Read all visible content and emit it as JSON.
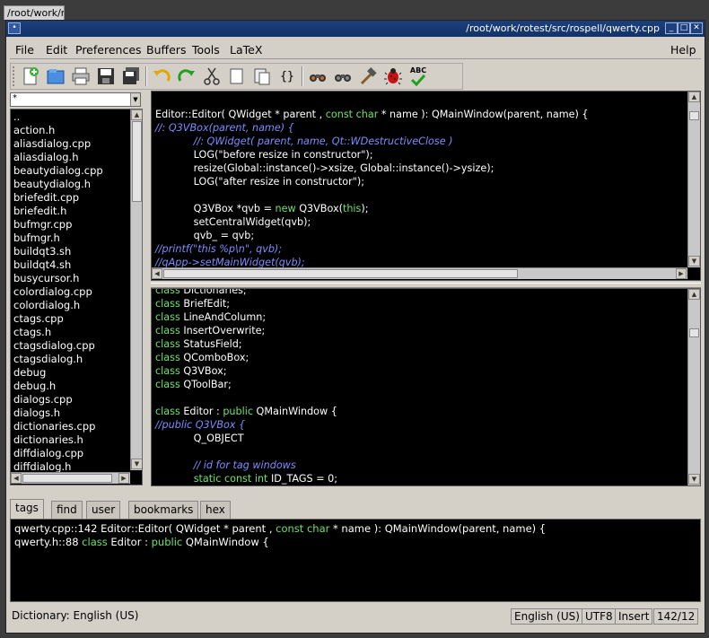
{
  "taskbar_tab": "/root/work/ro",
  "window": {
    "title": "/root/work/rotest/src/rospell/qwerty.cpp",
    "controls": {
      "minimize": "_",
      "maximize": "□",
      "close": "✕"
    }
  },
  "menubar": {
    "items": [
      "File",
      "Edit",
      "Preferences",
      "Buffers",
      "Tools",
      "LaTeX"
    ],
    "help": "Help"
  },
  "toolbar": {
    "buttons": [
      "new-file-icon",
      "open-file-icon",
      "print-icon",
      "save-icon",
      "save-all-icon",
      "undo-icon",
      "redo-icon",
      "cut-icon",
      "copy-icon",
      "paste-icon",
      "braces-icon",
      "find-icon",
      "find-next-icon",
      "build-icon",
      "debug-icon",
      "spellcheck-icon"
    ],
    "braces_label": "{}",
    "spell_label": "ABC"
  },
  "file_panel": {
    "filter_value": "*",
    "files": [
      "..",
      "action.h",
      "aliasdialog.cpp",
      "aliasdialog.h",
      "beautydialog.cpp",
      "beautydialog.h",
      "briefedit.cpp",
      "briefedit.h",
      "bufmgr.cpp",
      "bufmgr.h",
      "buildqt3.sh",
      "buildqt4.sh",
      "busycursor.h",
      "colordialog.cpp",
      "colordialog.h",
      "ctags.cpp",
      "ctags.h",
      "ctagsdialog.cpp",
      "ctagsdialog.h",
      "debug",
      "debug.h",
      "dialogs.cpp",
      "dialogs.h",
      "dictionaries.cpp",
      "dictionaries.h",
      "diffdialog.cpp",
      "diffdialog.h"
    ]
  },
  "editor_top": {
    "lines": [
      [
        {
          "t": ""
        }
      ],
      [
        {
          "t": "Editor::Editor( QWidget * parent , "
        },
        {
          "t": "const char",
          "c": "kw"
        },
        {
          "t": " * name ): QMainWindow(parent, name) {"
        }
      ],
      [
        {
          "t": "//: Q3VBox(parent, name) {",
          "c": "cm"
        }
      ],
      [
        {
          "t": "            "
        },
        {
          "t": "//: QWidget( parent, name, Qt::WDestructiveClose )",
          "c": "cm"
        }
      ],
      [
        {
          "t": "            LOG(\"before resize in constructor\");"
        }
      ],
      [
        {
          "t": "            resize(Global::instance()->xsize, Global::instance()->ysize);"
        }
      ],
      [
        {
          "t": "            LOG(\"after resize in constructor\");"
        }
      ],
      [
        {
          "t": ""
        }
      ],
      [
        {
          "t": "            Q3VBox *qvb = "
        },
        {
          "t": "new",
          "c": "kw"
        },
        {
          "t": " Q3VBox("
        },
        {
          "t": "this",
          "c": "kw"
        },
        {
          "t": ");"
        }
      ],
      [
        {
          "t": "            setCentralWidget(qvb);"
        }
      ],
      [
        {
          "t": "            qvb_ = qvb;"
        }
      ],
      [
        {
          "t": "//printf(\"this %p\\n\", qvb);",
          "c": "cm"
        }
      ],
      [
        {
          "t": "//qApp->setMainWidget(qvb);",
          "c": "cm"
        }
      ]
    ]
  },
  "editor_bottom": {
    "lines": [
      [
        {
          "t": "class",
          "c": "kw"
        },
        {
          "t": " Dictionaries;"
        }
      ],
      [
        {
          "t": "class",
          "c": "kw"
        },
        {
          "t": " BriefEdit;"
        }
      ],
      [
        {
          "t": "class",
          "c": "kw"
        },
        {
          "t": " LineAndColumn;"
        }
      ],
      [
        {
          "t": "class",
          "c": "kw"
        },
        {
          "t": " InsertOverwrite;"
        }
      ],
      [
        {
          "t": "class",
          "c": "kw"
        },
        {
          "t": " StatusField;"
        }
      ],
      [
        {
          "t": "class",
          "c": "kw"
        },
        {
          "t": " QComboBox;"
        }
      ],
      [
        {
          "t": "class",
          "c": "kw"
        },
        {
          "t": " Q3VBox;"
        }
      ],
      [
        {
          "t": "class",
          "c": "kw"
        },
        {
          "t": " QToolBar;"
        }
      ],
      [
        {
          "t": ""
        }
      ],
      [
        {
          "t": "class",
          "c": "kw"
        },
        {
          "t": " Editor : "
        },
        {
          "t": "public",
          "c": "kw"
        },
        {
          "t": " QMainWindow {"
        }
      ],
      [
        {
          "t": "//public Q3VBox {",
          "c": "cm"
        }
      ],
      [
        {
          "t": "            Q_OBJECT"
        }
      ],
      [
        {
          "t": ""
        }
      ],
      [
        {
          "t": "            "
        },
        {
          "t": "// id for tag windows",
          "c": "cm"
        }
      ],
      [
        {
          "t": "            "
        },
        {
          "t": "static const int",
          "c": "kw"
        },
        {
          "t": " ID_TAGS = 0;"
        }
      ]
    ]
  },
  "bottom_tabs": [
    "tags",
    "find",
    "user",
    "bookmarks",
    "hex"
  ],
  "output": {
    "lines": [
      [
        {
          "t": "qwerty.cpp::142 Editor::Editor( QWidget * parent , "
        },
        {
          "t": "const char",
          "c": "kw"
        },
        {
          "t": " * name ): QMainWindow(parent, name) {"
        }
      ],
      [
        {
          "t": "qwerty.h::88 "
        },
        {
          "t": "class",
          "c": "kw"
        },
        {
          "t": " Editor : "
        },
        {
          "t": "public",
          "c": "kw"
        },
        {
          "t": " QMainWindow {"
        }
      ]
    ]
  },
  "statusbar": {
    "message": "Dictionary: English (US)",
    "language": "English (US)",
    "encoding": "UTF8",
    "mode": "Insert",
    "position": "142/12"
  }
}
